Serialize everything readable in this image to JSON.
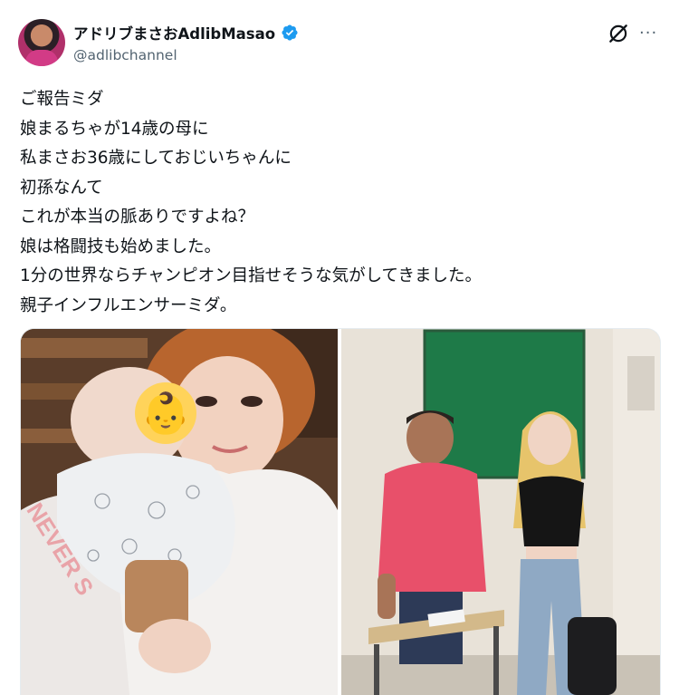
{
  "author": {
    "display_name": "アドリブまさおAdlibMasao",
    "handle": "@adlibchannel",
    "verified_icon": "verified-badge-icon"
  },
  "actions": {
    "grok_icon": "grok-icon",
    "more_icon": "more-icon",
    "more_label": "···"
  },
  "post": {
    "lines": [
      "ご報告ミダ",
      "娘まるちゃが14歳の母に",
      "私まさお36歳にしておじいちゃんに",
      "初孫なんて",
      "これが本当の脈ありですよね？",
      "娘は格闘技も始めました。",
      "1分の世界ならチャンピオン目指せそうな気がしてきました。",
      "親子インフルエンサーミダ。"
    ]
  },
  "media": {
    "photos": [
      {
        "name": "photo-mother-and-baby",
        "baby_emoji": "👶",
        "shirt_text": "NEVER S"
      },
      {
        "name": "photo-couple-classroom"
      }
    ]
  },
  "colors": {
    "verified_blue": "#1d9bf0",
    "secondary_text": "#536471",
    "primary_text": "#0f1419"
  }
}
